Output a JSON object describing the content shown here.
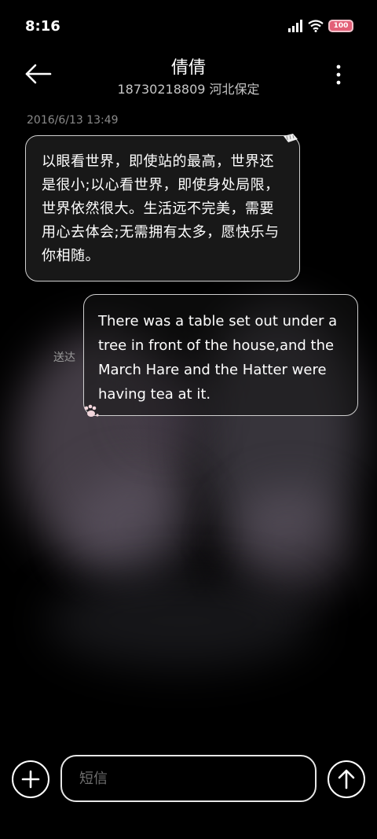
{
  "status_bar": {
    "time": "8:16",
    "battery": "100",
    "icons": [
      "signal-icon",
      "wifi-icon",
      "battery-icon"
    ],
    "battery_color": "#e36078"
  },
  "header": {
    "contact_name": "倩倩",
    "contact_detail": "18730218809 河北保定",
    "icons": [
      "back-arrow-icon",
      "more-vertical-icon"
    ]
  },
  "conversation": {
    "timestamp": "2016/6/13 13:49",
    "incoming_message": "以眼看世界，即使站的最高，世界还是很小;以心看世界，即使身处局限，世界依然很大。生活远不完美，需要用心去体会;无需拥有太多，愿快乐与你相随。",
    "outgoing_message": "There was a table set out under a tree in front of the house,and the March Hare and the Hatter were having tea at it.",
    "outgoing_status": "送达"
  },
  "composer": {
    "placeholder": "短信",
    "value": "",
    "icons": [
      "plus-icon",
      "send-arrow-up-icon"
    ]
  },
  "colors": {
    "background": "#000000",
    "bubble_border": "#cfcfcf",
    "timestamp": "#8a8a8a"
  }
}
